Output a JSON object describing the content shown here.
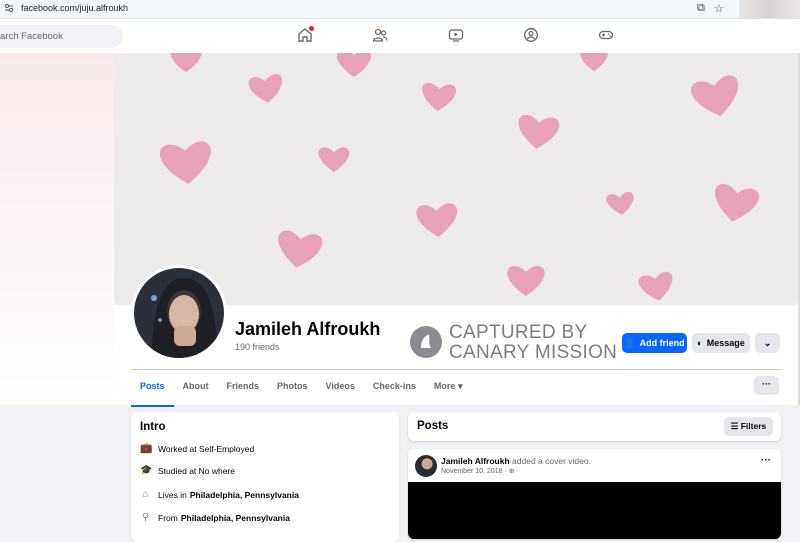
{
  "browser": {
    "url": "facebook.com/juju.alfroukh"
  },
  "nav": {
    "search_placeholder": "Search Facebook",
    "search_visible": "arch Facebook",
    "icons": [
      "home-icon",
      "friends-icon",
      "video-icon",
      "groups-icon",
      "gaming-icon"
    ]
  },
  "profile": {
    "name": "Jamileh Alfroukh",
    "friends": "190 friends",
    "add_friend": "Add friend",
    "message": "Message"
  },
  "watermark": {
    "line1": "CAPTURED BY",
    "line2": "CANARY MISSION"
  },
  "tabs": [
    "Posts",
    "About",
    "Friends",
    "Photos",
    "Videos",
    "Check-ins",
    "More"
  ],
  "intro": {
    "title": "Intro",
    "work": {
      "prefix": "Worked at Self-Employed"
    },
    "study": {
      "prefix": "Studied at No where"
    },
    "lives": {
      "prefix": "Lives in",
      "place": "Philadelphia, Pennsylvania"
    },
    "from": {
      "prefix": "From",
      "place": "Philadelphia, Pennsylvania"
    }
  },
  "posts": {
    "title": "Posts",
    "filters": "Filters",
    "post": {
      "author": "Jamileh Alfroukh",
      "action": "added a cover video.",
      "date": "November 10, 2018 ·"
    }
  },
  "colors": {
    "accent": "#0866ff",
    "heart": "#e58aa6"
  }
}
